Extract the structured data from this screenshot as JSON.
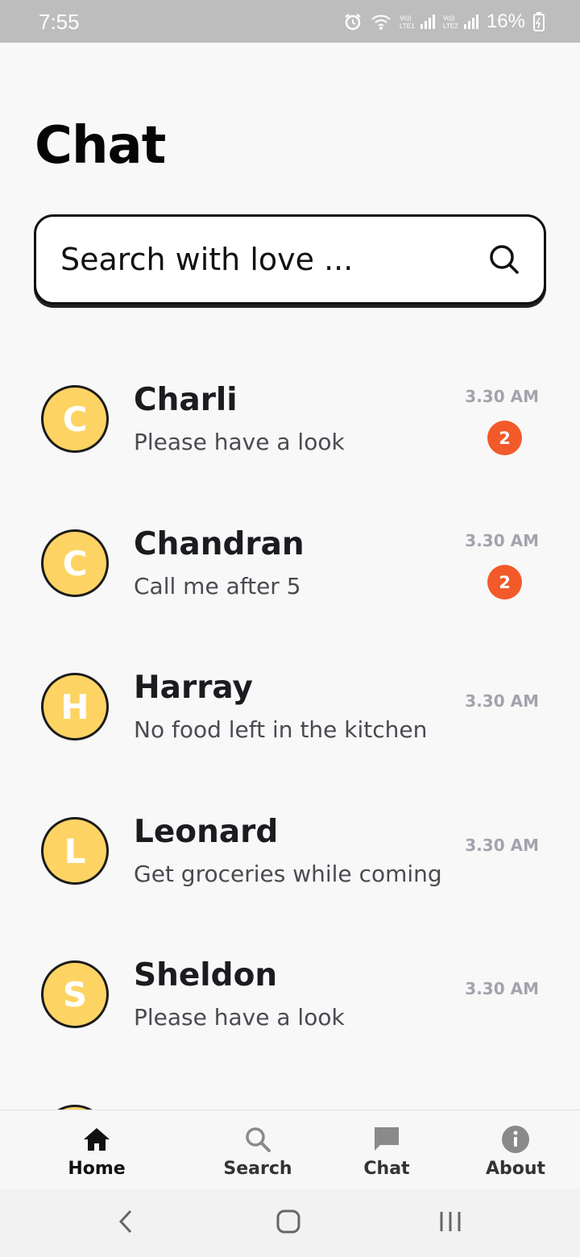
{
  "status_bar": {
    "time": "7:55",
    "battery": "16%",
    "icons": [
      "alarm-icon",
      "wifi-icon",
      "signal-lte1-icon",
      "signal-lte2-icon",
      "battery-charging-icon"
    ]
  },
  "header": {
    "title": "Chat"
  },
  "search": {
    "placeholder": "Search with love ..."
  },
  "chats": [
    {
      "initial": "C",
      "name": "Charli",
      "message": "Please have a look",
      "time": "3.30 AM",
      "unread": "2"
    },
    {
      "initial": "C",
      "name": "Chandran",
      "message": "Call me after 5",
      "time": "3.30 AM",
      "unread": "2"
    },
    {
      "initial": "H",
      "name": "Harray",
      "message": "No food left in the kitchen",
      "time": "3.30 AM",
      "unread": null
    },
    {
      "initial": "L",
      "name": "Leonard",
      "message": "Get groceries while coming",
      "time": "3.30 AM",
      "unread": null
    },
    {
      "initial": "S",
      "name": "Sheldon",
      "message": "Please have a look",
      "time": "3.30 AM",
      "unread": null
    }
  ],
  "bottom_nav": [
    {
      "label": "Home",
      "icon": "home-icon",
      "active": true
    },
    {
      "label": "Search",
      "icon": "search-icon",
      "active": false
    },
    {
      "label": "Chat",
      "icon": "chat-icon",
      "active": false
    },
    {
      "label": "About",
      "icon": "info-icon",
      "active": false
    }
  ],
  "colors": {
    "avatar_bg": "#fdd464",
    "badge": "#f25a29",
    "time_text": "#a3a3ad",
    "status_bar": "#bdbdbd"
  }
}
